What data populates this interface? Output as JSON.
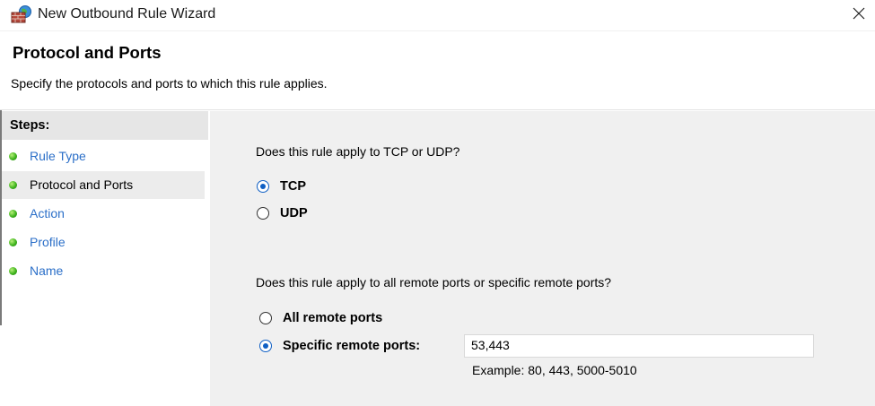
{
  "window": {
    "title": "New Outbound Rule Wizard",
    "app_icon": "firewall-icon",
    "close_icon": "close-icon"
  },
  "header": {
    "title": "Protocol and Ports",
    "subtitle": "Specify the protocols and ports to which this rule applies."
  },
  "sidebar": {
    "steps_label": "Steps:",
    "items": [
      {
        "label": "Rule Type",
        "active": false
      },
      {
        "label": "Protocol and Ports",
        "active": true
      },
      {
        "label": "Action",
        "active": false
      },
      {
        "label": "Profile",
        "active": false
      },
      {
        "label": "Name",
        "active": false
      }
    ]
  },
  "protocol": {
    "question": "Does this rule apply to TCP or UDP?",
    "options": [
      {
        "label": "TCP",
        "checked": true
      },
      {
        "label": "UDP",
        "checked": false
      }
    ]
  },
  "ports": {
    "question": "Does this rule apply to all remote ports or specific remote ports?",
    "options": [
      {
        "label": "All remote ports",
        "checked": false
      },
      {
        "label": "Specific remote ports:",
        "checked": true
      }
    ],
    "value": "53,443",
    "example": "Example: 80, 443, 5000-5010"
  },
  "colors": {
    "accent": "#0f5fc4",
    "link": "#2b6fc8",
    "content_bg": "#f0f0f0",
    "step_dot": "#3fb41e"
  }
}
